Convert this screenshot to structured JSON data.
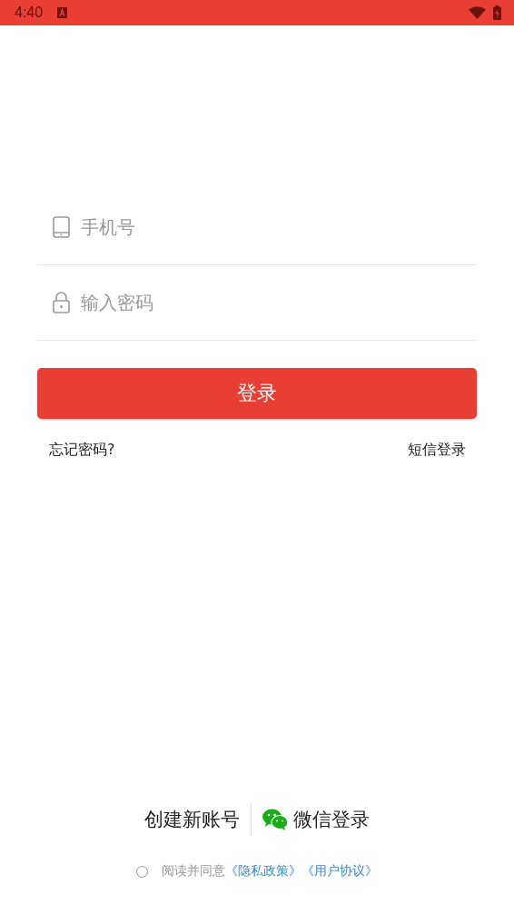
{
  "status_bar": {
    "time": "4:40"
  },
  "phone_field": {
    "placeholder": "手机号"
  },
  "password_field": {
    "placeholder": "输入密码"
  },
  "login_button": "登录",
  "forgot_link": "忘记密码?",
  "sms_link": "短信登录",
  "create_account": "创建新账号",
  "wechat_login": "微信登录",
  "agreement": {
    "checked": false,
    "text": "阅读并同意",
    "links": [
      "《隐私政策》",
      "《用户协议》"
    ]
  }
}
